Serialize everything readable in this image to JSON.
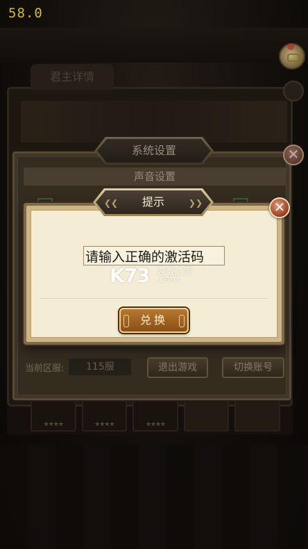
{
  "hud": {
    "fps": "58.0"
  },
  "background": {
    "tab_label": "君主详情",
    "card_stars": "★★★★"
  },
  "settings": {
    "title": "系统设置",
    "section": "声音设置",
    "server_label": "当前区服:",
    "server_value": "115服",
    "quit_label": "退出游戏",
    "switch_label": "切换账号",
    "close_glyph": "✕"
  },
  "prompt": {
    "title": "提示",
    "title_deco_left": "❮❮",
    "title_deco_right": "❯❯",
    "input_value": "请输入正确的激活码",
    "redeem_label": "兑换",
    "close_glyph": "✕"
  },
  "watermark": {
    "brand": "K73",
    "cn": "游戏之家",
    "domain": ".com"
  },
  "colors": {
    "accent_gold": "#f1d596",
    "button_brown": "#8a4f16",
    "close_red": "#9a3d24",
    "fps_yellow": "#ffe24a"
  }
}
